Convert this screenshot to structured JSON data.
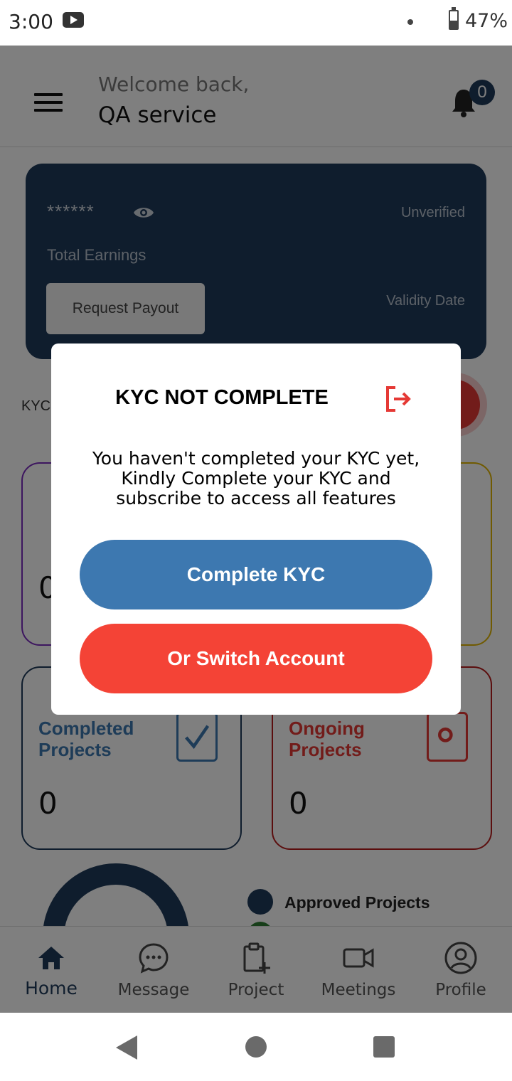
{
  "status_bar": {
    "time": "3:00",
    "battery": "47%",
    "battery_level": 0.47
  },
  "header": {
    "welcome": "Welcome back,",
    "username": "QA service",
    "notification_count": "0"
  },
  "earnings_card": {
    "masked_amount": "******",
    "status": "Unverified",
    "total_label": "Total Earnings",
    "payout_button": "Request Payout",
    "validity_label": "Validity Date"
  },
  "kyc_label": "KYC",
  "stat_cards": [
    {
      "title": "Completed Projects",
      "value": "0",
      "color": "#1f3a5a",
      "icon": "clipboard-check-icon"
    },
    {
      "title": "Ongoing Projects",
      "value": "0",
      "color": "#b71c1c",
      "icon": "clipboard-gear-icon"
    }
  ],
  "partial_cards": {
    "left_value": "0"
  },
  "legend": {
    "approved": "Approved Projects",
    "approved_color": "#1f3a5a",
    "second_color": "#2e7d32"
  },
  "bottom_nav": {
    "items": [
      {
        "label": "Home",
        "icon": "home-icon",
        "active": true
      },
      {
        "label": "Message",
        "icon": "message-icon",
        "active": false
      },
      {
        "label": "Project",
        "icon": "clipboard-plus-icon",
        "active": false
      },
      {
        "label": "Meetings",
        "icon": "video-camera-icon",
        "active": false
      },
      {
        "label": "Profile",
        "icon": "user-circle-icon",
        "active": false
      }
    ]
  },
  "dialog": {
    "title": "KYC NOT COMPLETE",
    "message": "You haven't completed your KYC yet, Kindly Complete your KYC and subscribe to access all features",
    "primary_button": "Complete KYC",
    "secondary_button": "Or Switch Account",
    "primary_color": "#3d78b0",
    "secondary_color": "#f44336",
    "logout_icon_color": "#e53935"
  }
}
